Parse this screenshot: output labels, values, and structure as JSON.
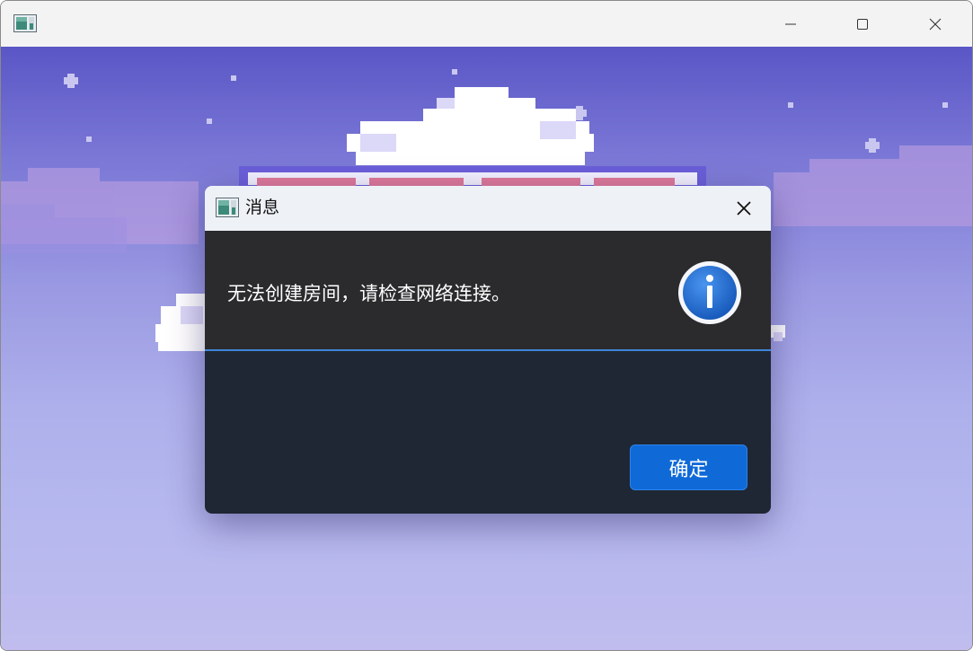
{
  "window": {
    "title_icon": "app-icon",
    "controls": {
      "minimize": "minimize-icon",
      "maximize": "maximize-icon",
      "close": "close-icon"
    }
  },
  "dialog": {
    "title": "消息",
    "message": "无法创建房间，请检查网络连接。",
    "icon": "info-icon",
    "ok_label": "确定",
    "accent_color": "#0f6ad8"
  }
}
